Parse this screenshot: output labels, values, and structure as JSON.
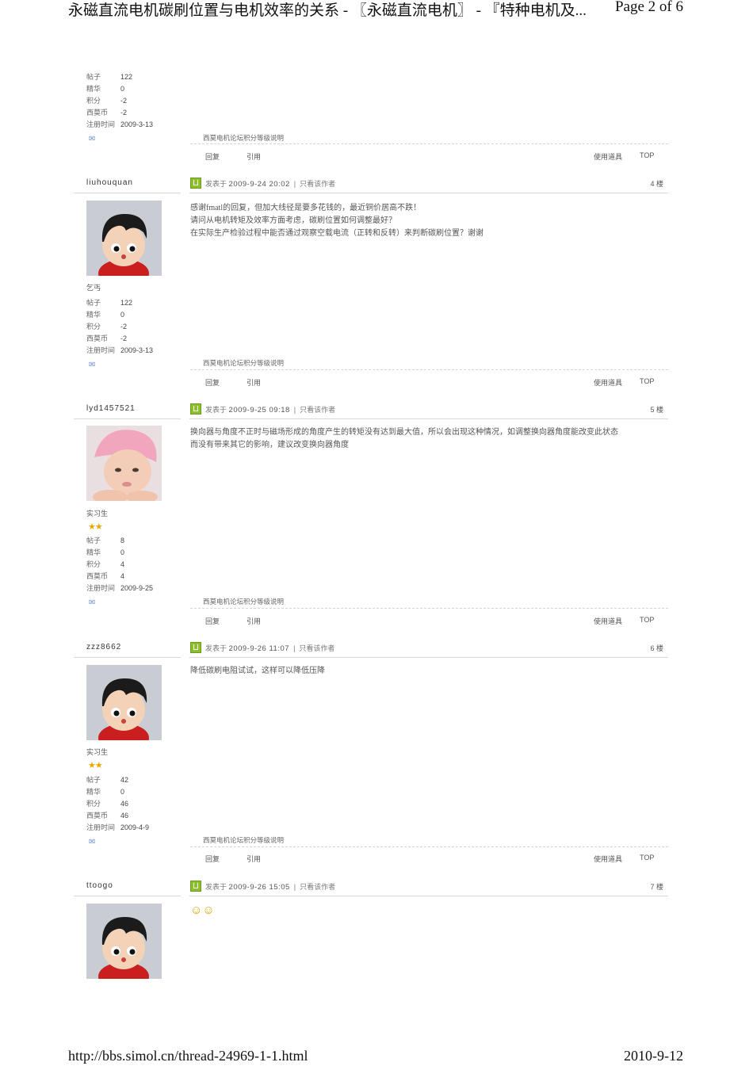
{
  "header": {
    "title": "永磁直流电机碳刷位置与电机效率的关系 - 〖永磁直流电机〗 - 『特种电机及...",
    "page": "Page 2 of 6"
  },
  "footer": {
    "url": "http://bbs.simol.cn/thread-24969-1-1.html",
    "date": "2010-9-12"
  },
  "labels": {
    "posts": "帖子",
    "digest": "精华",
    "points": "积分",
    "coins": "西莫币",
    "registered": "注册时间",
    "posted_at": "发表于",
    "only_author": "只看该作者",
    "floor_suffix": "楼",
    "signature": "西莫电机论坛积分等级说明",
    "reply": "回复",
    "quote": "引用",
    "tools": "使用道具",
    "top": "TOP"
  },
  "first_post_tail": {
    "stats": {
      "posts": "122",
      "digest": "0",
      "points": "-2",
      "coins": "-2",
      "registered": "2009-3-13"
    }
  },
  "posts": [
    {
      "username": "liuhouquan",
      "avatar": "cartoon-boy",
      "rank": "乞丐",
      "stars": "",
      "stats": {
        "posts": "122",
        "digest": "0",
        "points": "-2",
        "coins": "-2",
        "registered": "2009-3-13"
      },
      "datetime": "2009-9-24 20:02",
      "floor": "4",
      "lines": [
        "感谢fmatl的回复，但加大线径是要多花钱的，最近铜价居高不跌！",
        "请问从电机转矩及效率方面考虑，碳刷位置如何调整最好？",
        "在实际生产检验过程中能否通过观察空载电流（正转和反转）来判断碳刷位置？谢谢"
      ]
    },
    {
      "username": "lyd1457521",
      "avatar": "baby-pink-cap",
      "rank": "实习生",
      "stars": "★★",
      "stats": {
        "posts": "8",
        "digest": "0",
        "points": "4",
        "coins": "4",
        "registered": "2009-9-25"
      },
      "datetime": "2009-9-25 09:18",
      "floor": "5",
      "lines": [
        "换向器与角度不正时与磁场形成的角度产生的转矩没有达到最大值，所以会出现这种情况，如调整换向器角度能改变此状态",
        "而没有带来其它的影响，建议改变换向器角度"
      ]
    },
    {
      "username": "zzz8662",
      "avatar": "cartoon-boy",
      "rank": "实习生",
      "stars": "★★",
      "stats": {
        "posts": "42",
        "digest": "0",
        "points": "46",
        "coins": "46",
        "registered": "2009-4-9"
      },
      "datetime": "2009-9-26 11:07",
      "floor": "6",
      "lines": [
        "降低碳刷电阻试试，这样可以降低压降"
      ]
    },
    {
      "username": "ttoogo",
      "avatar": "cartoon-boy",
      "datetime": "2009-9-26 15:05",
      "floor": "7",
      "emoji": "☺☺"
    }
  ],
  "colors": {
    "icon_green": "#8bbf2c",
    "star": "#e8a800",
    "rule": "#d8d8d8"
  }
}
